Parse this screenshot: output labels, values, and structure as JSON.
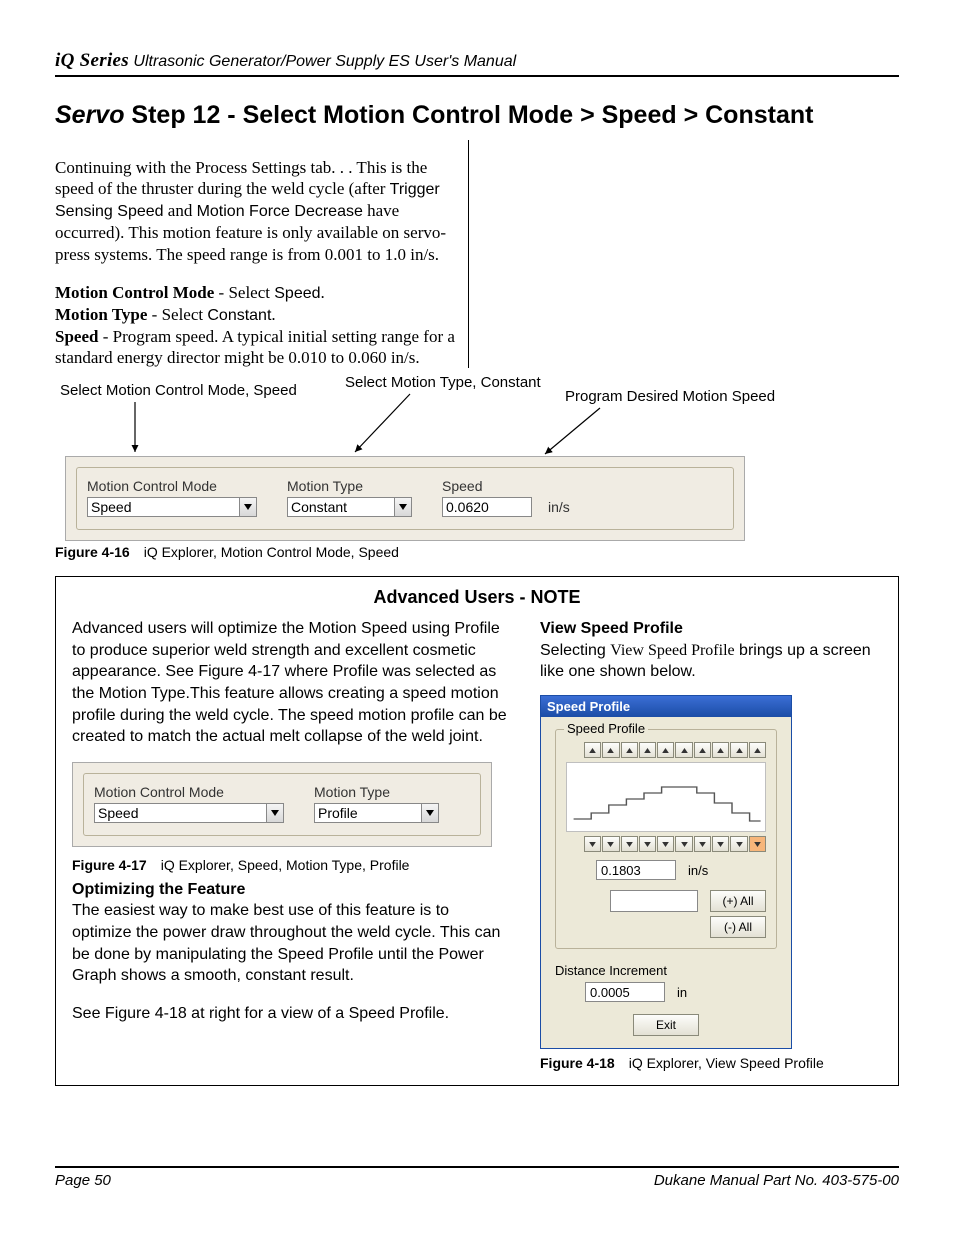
{
  "header": {
    "brand": "iQ Series",
    "rest": " Ultrasonic Generator/Power Supply ES User's Manual"
  },
  "title": {
    "servo": "Servo",
    "rest": " Step 12 - Select Motion Control Mode > Speed > Constant"
  },
  "para": {
    "p1a": "Continuing with the Process Settings tab. . . This is the speed of the thruster during the weld cycle (after ",
    "p1b": "Trigger Sensing Speed",
    "p1c": " and ",
    "p1d": "Motion Force Decrease",
    "p1e": " have occurred). This motion feature is only available on servo-press systems. The speed range is from 0.001 to 1.0 in/s.",
    "l1a": "Motion Control Mode",
    "l1b": " - Select ",
    "l1c": "Speed",
    "l1d": ".",
    "l2a": "Motion Type",
    "l2b": " - Select ",
    "l2c": "Constant",
    "l2d": ".",
    "l3a": "Speed",
    "l3b": " - Program speed. A typical initial setting range for a standard energy director might be 0.010 to 0.060 in/s."
  },
  "callouts": {
    "c1": "Select Motion Control Mode, Speed",
    "c2": "Select Motion Type, Constant",
    "c3": "Program Desired Motion Speed"
  },
  "ui16": {
    "mcm_label": "Motion Control Mode",
    "mcm_value": "Speed",
    "mtype_label": "Motion Type",
    "mtype_value": "Constant",
    "speed_label": "Speed",
    "speed_value": "0.0620",
    "speed_unit": "in/s"
  },
  "fig16": {
    "label": "Figure 4-16",
    "text": "iQ Explorer, Motion Control Mode, Speed"
  },
  "noteTitle": "Advanced Users - NOTE",
  "noteLeft": {
    "p1a": "Advanced users will optimize the Motion Speed using Profile to produce superior weld strength and excellent cosmetic appearance. See Figure 4-17 where Profile was selected as the Motion Type.This feature allows creating a speed motion profile during the weld cycle. The speed motion profile can be created to match the actual melt collapse of the weld joint.",
    "optH": "Optimizing the Feature",
    "opt1": "The easiest way to make best use of this feature is to optimize the power draw throughout the weld cycle. This can be done by manipulating the Speed Profile until the Power Graph shows a smooth, constant result.",
    "opt2": "See Figure 4-18 at right for a view of a Speed Profile."
  },
  "ui17": {
    "mcm_label": "Motion Control Mode",
    "mcm_value": "Speed",
    "mtype_label": "Motion Type",
    "mtype_value": "Profile"
  },
  "fig17": {
    "label": "Figure 4-17",
    "text": "iQ Explorer, Speed, Motion Type, Profile"
  },
  "noteRight": {
    "h": "View Speed Profile",
    "p1a": "Selecting ",
    "p1b": "View Speed Profile",
    "p1c": " brings up a screen like one shown below."
  },
  "sp": {
    "title": "Speed Profile",
    "legend": "Speed Profile",
    "value": "0.1803",
    "unit": "in/s",
    "plusAll": "(+) All",
    "minusAll": "(-) All",
    "distLabel": "Distance Increment",
    "distVal": "0.0005",
    "distUnit": "in",
    "exit": "Exit"
  },
  "fig18": {
    "label": "Figure 4-18",
    "text": "iQ Explorer, View Speed Profile"
  },
  "footer": {
    "left": "Page   50",
    "right": "Dukane Manual Part No. 403-575-00"
  }
}
